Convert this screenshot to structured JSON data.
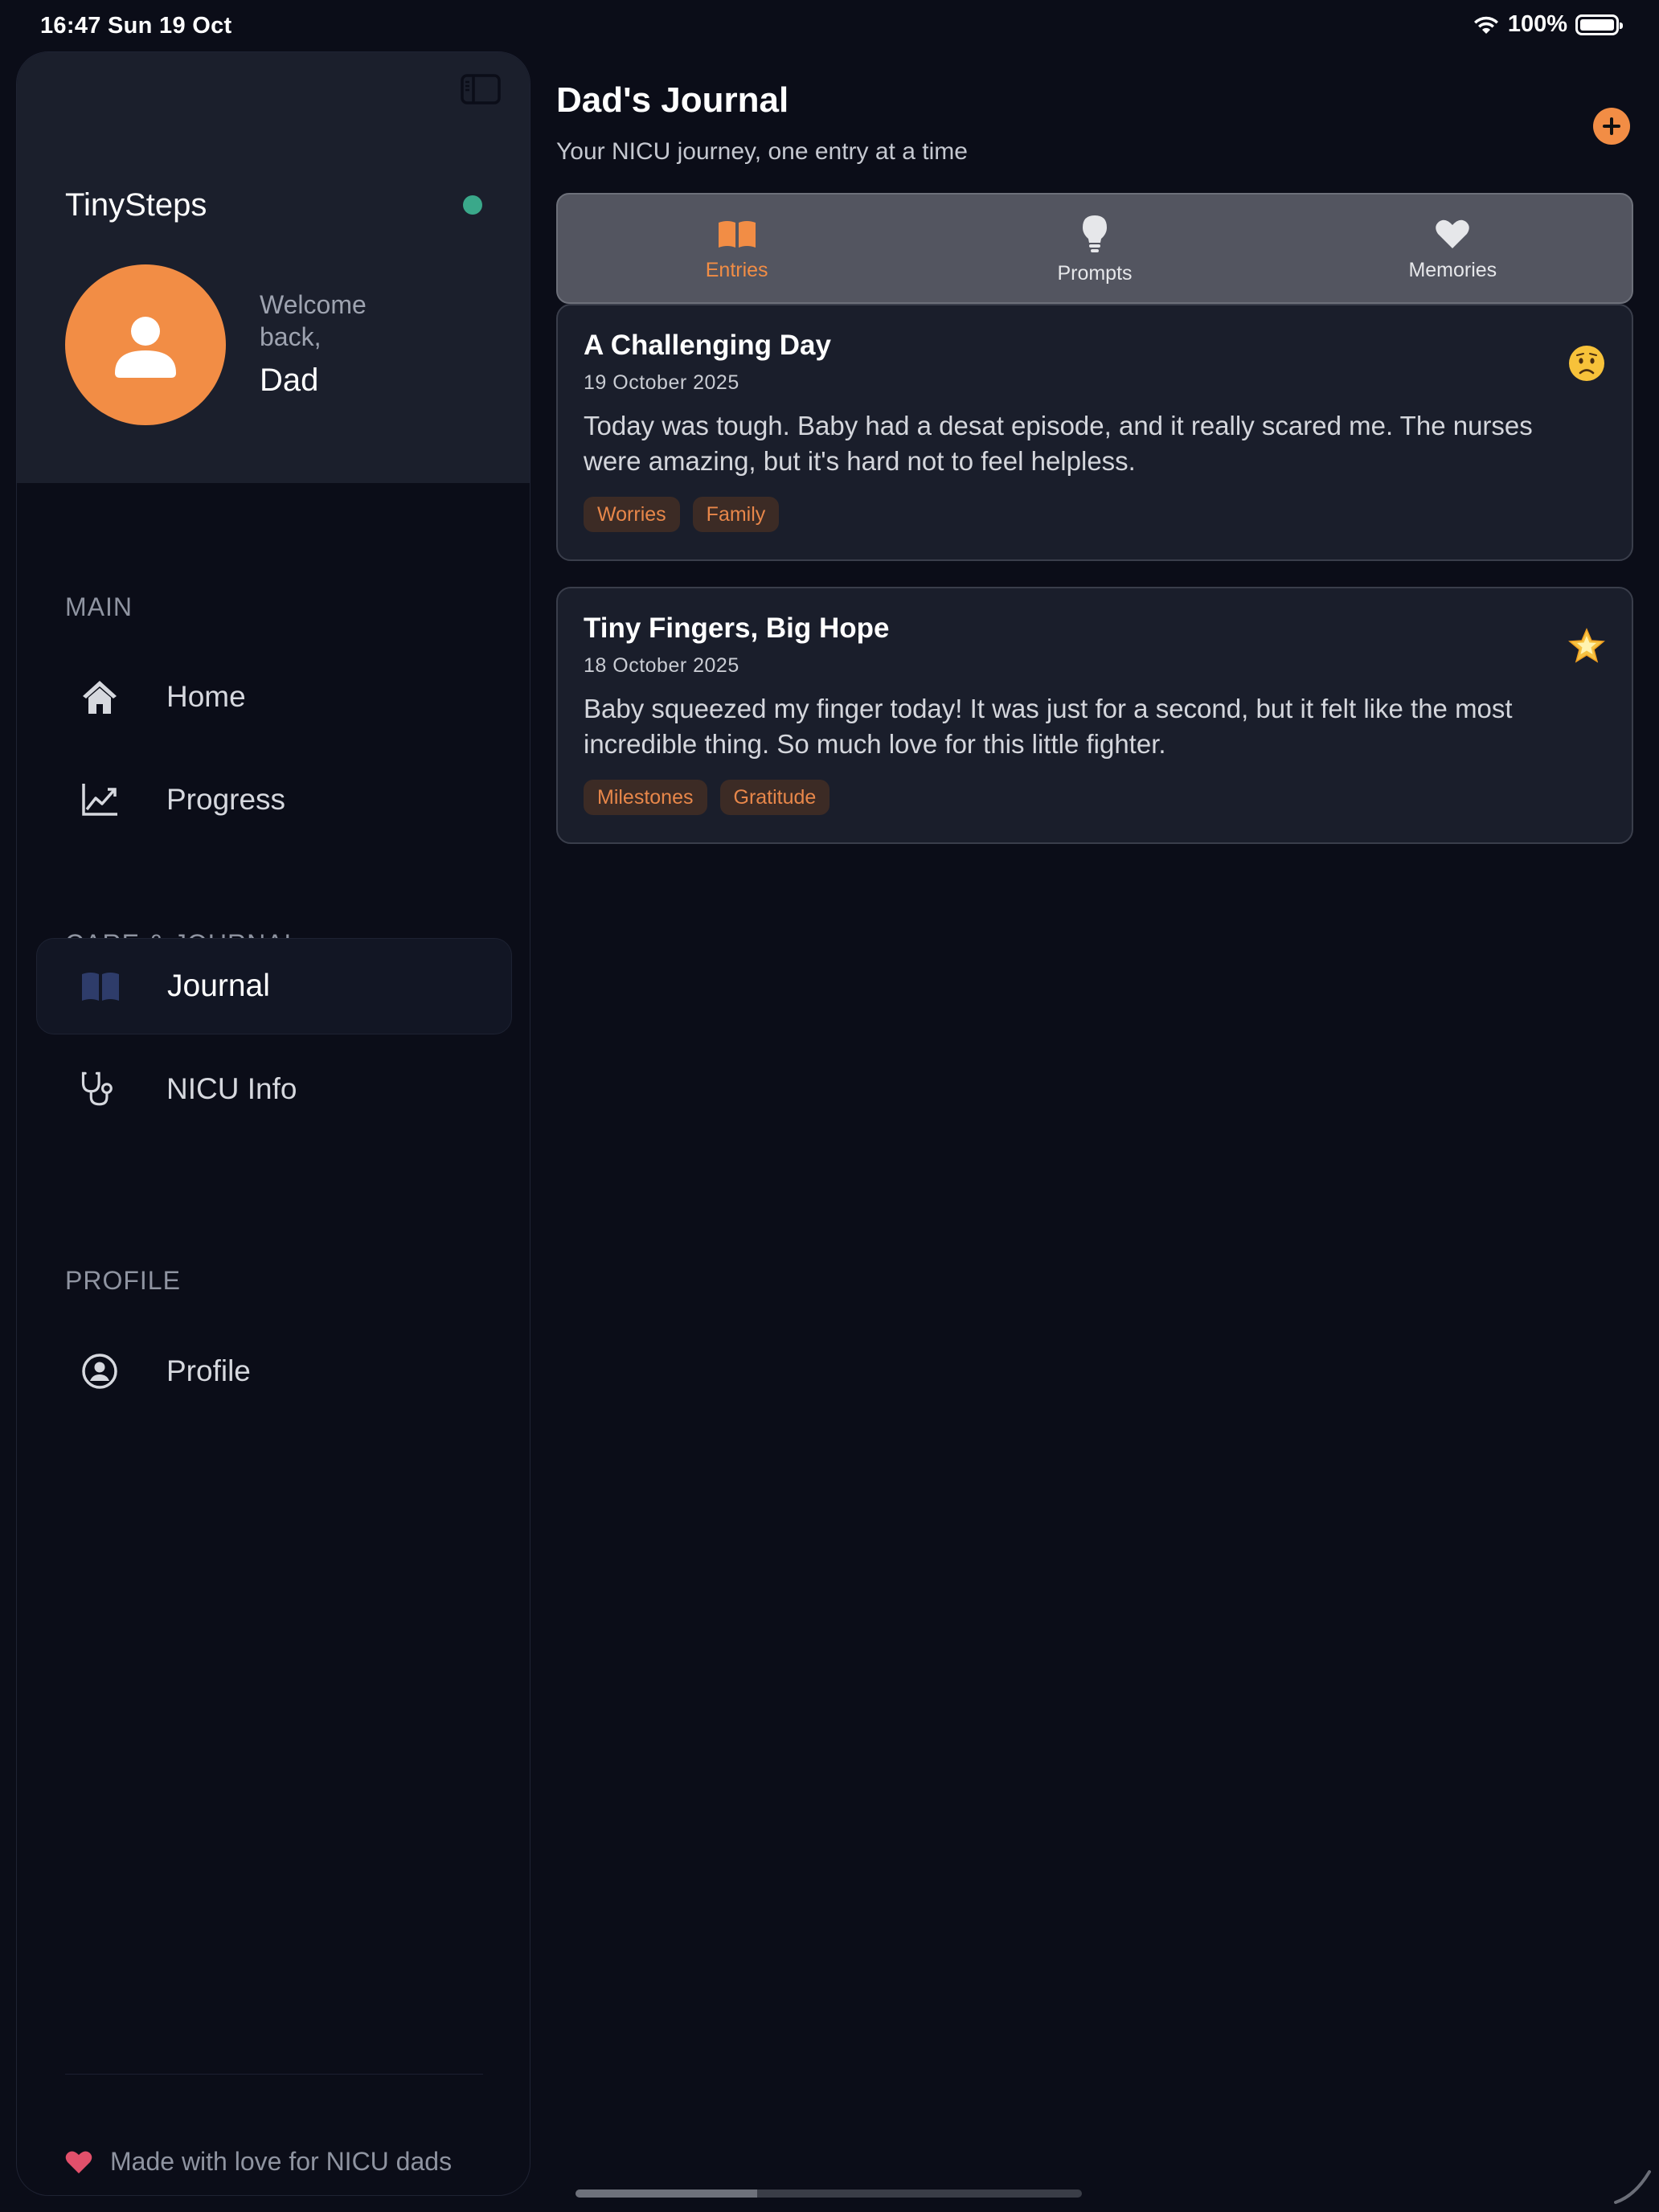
{
  "status_bar": {
    "time_date": "16:47  Sun 19 Oct",
    "battery": "100%"
  },
  "sidebar": {
    "app_name": "TinySteps",
    "welcome": "Welcome back,",
    "user_name": "Dad",
    "sections": {
      "main": "MAIN",
      "care": "CARE & JOURNAL",
      "profile": "PROFILE"
    },
    "items": [
      {
        "label": "Home",
        "icon": "house-icon"
      },
      {
        "label": "Progress",
        "icon": "chart-line-icon"
      },
      {
        "label": "Journal",
        "icon": "book-icon",
        "active": true
      },
      {
        "label": "NICU Info",
        "icon": "stethoscope-icon"
      },
      {
        "label": "Profile",
        "icon": "person-circle-icon"
      }
    ],
    "footer": "Made with love for NICU dads"
  },
  "main": {
    "title": "Dad's Journal",
    "subtitle": "Your NICU journey, one entry at a time",
    "tabs": [
      {
        "label": "Entries",
        "icon": "book-icon",
        "active": true
      },
      {
        "label": "Prompts",
        "icon": "lightbulb-icon"
      },
      {
        "label": "Memories",
        "icon": "heart-icon"
      }
    ],
    "entries": [
      {
        "title": "A Challenging Day",
        "date": "19 October 2025",
        "body": "Today was tough. Baby had a desat episode, and it really scared me. The nurses were amazing, but it's hard not to feel helpless.",
        "mood": "worried-face-emoji",
        "tags": [
          "Worries",
          "Family"
        ]
      },
      {
        "title": "Tiny Fingers, Big Hope",
        "date": "18 October 2025",
        "body": "Baby squeezed my finger today! It was just for a second, but it felt like the most incredible thing. So much love for this little fighter.",
        "mood": "star-emoji",
        "tags": [
          "Milestones",
          "Gratitude"
        ]
      }
    ]
  },
  "colors": {
    "background": "#0b0d18",
    "panel": "#1b1f2c",
    "accent": "#f28d45",
    "online": "#3aa88a",
    "heart": "#e2506b"
  }
}
